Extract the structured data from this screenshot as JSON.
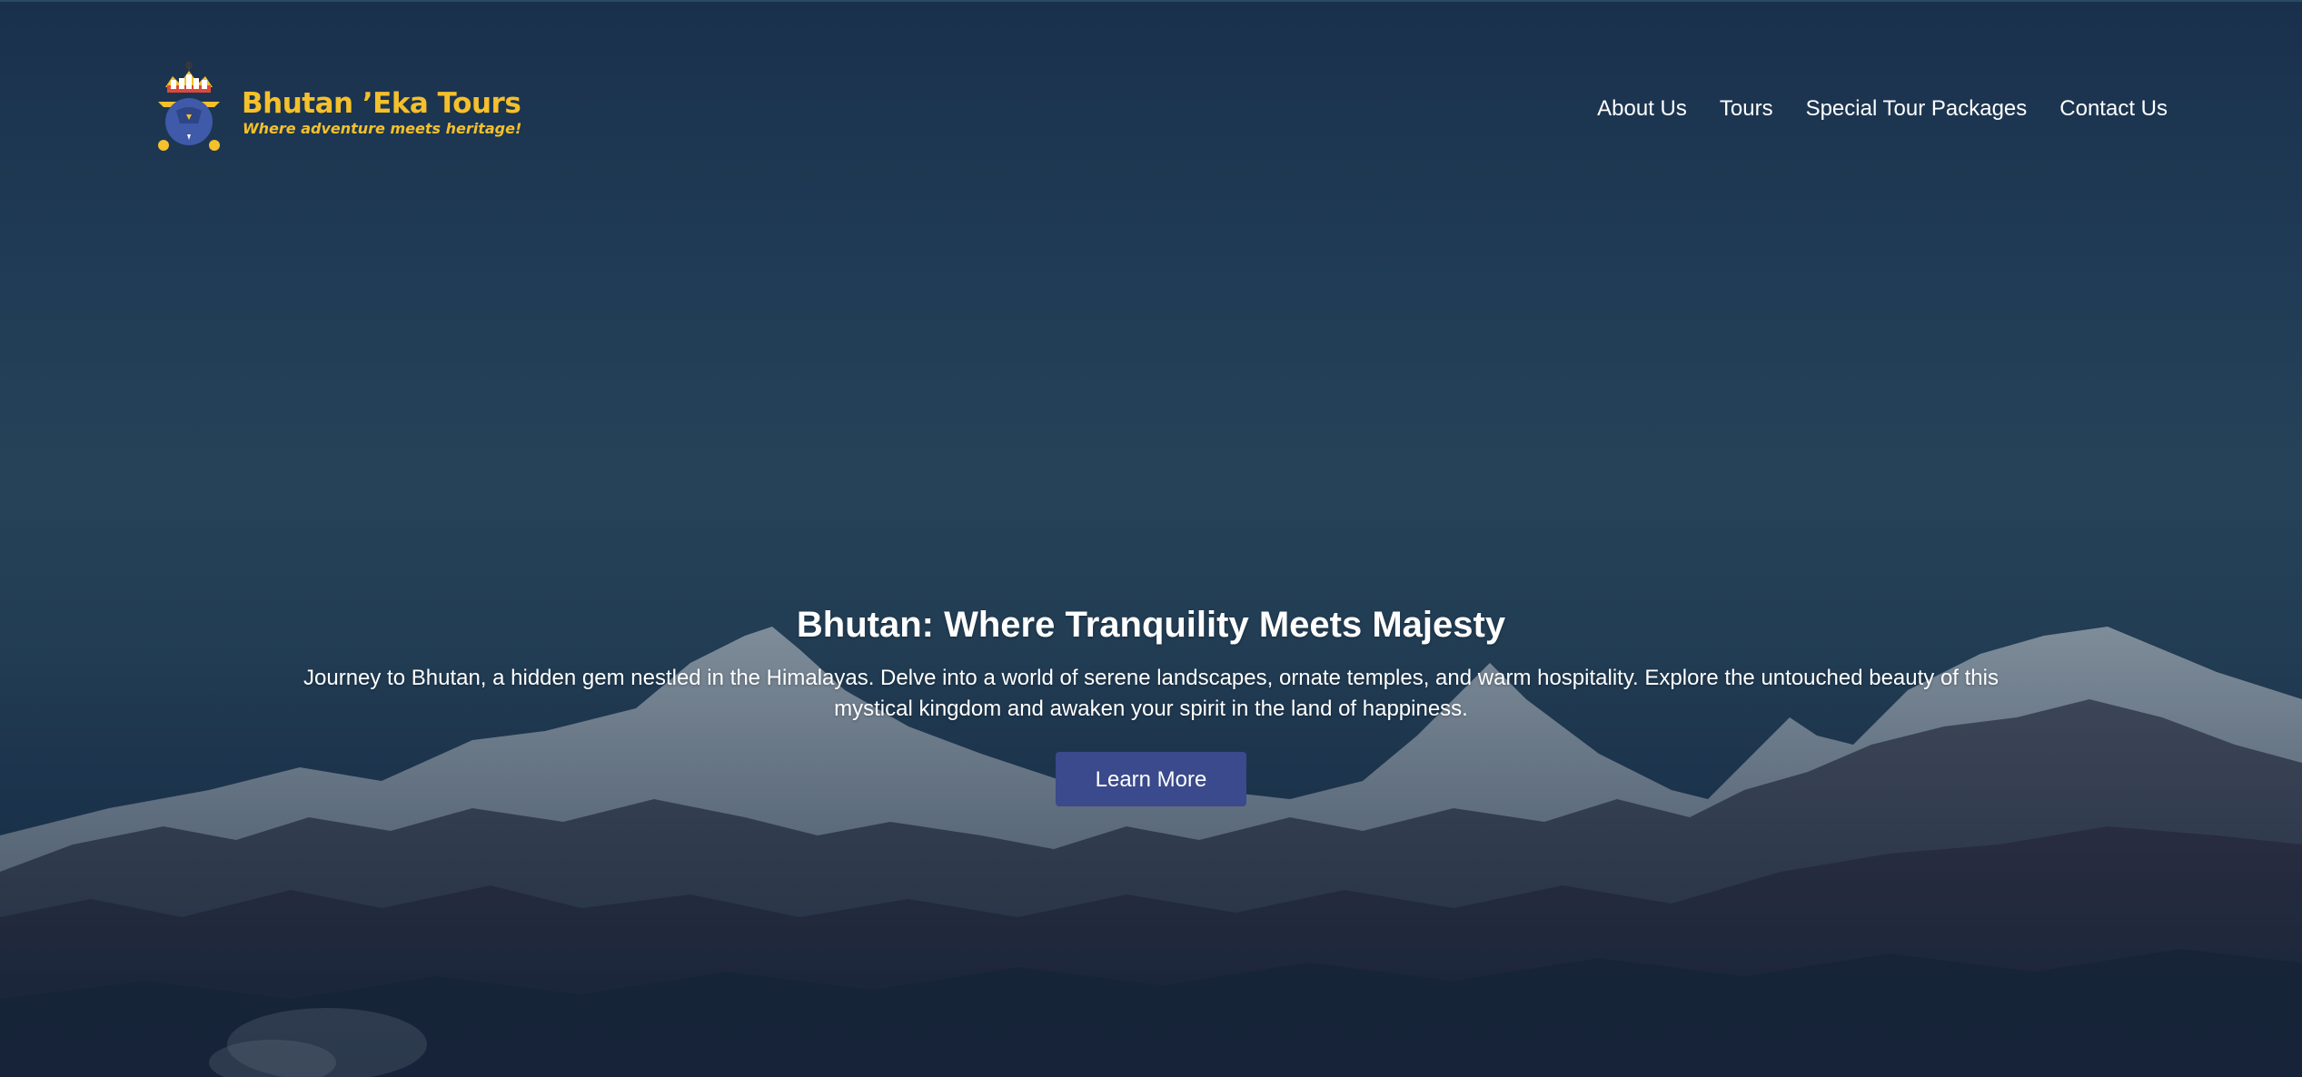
{
  "brand": {
    "name": "Bhutan ’Eka Tours",
    "tagline": "Where adventure meets heritage!",
    "logo_icon": "dzong-emblem-icon",
    "accent_color": "#f4c02c"
  },
  "nav": {
    "items": [
      {
        "label": "About Us"
      },
      {
        "label": "Tours"
      },
      {
        "label": "Special Tour Packages"
      },
      {
        "label": "Contact Us"
      }
    ]
  },
  "hero": {
    "title": "Bhutan: Where Tranquility Meets Majesty",
    "text": "Journey to Bhutan, a hidden gem nestled in the Himalayas. Delve into a world of serene landscapes, ornate temples, and warm hospitality. Explore the untouched beauty of this mystical kingdom and awaken your spirit in the land of happiness.",
    "cta_label": "Learn More",
    "cta_color": "#3a4a8c",
    "background": "himalaya-mountain-range-image"
  }
}
